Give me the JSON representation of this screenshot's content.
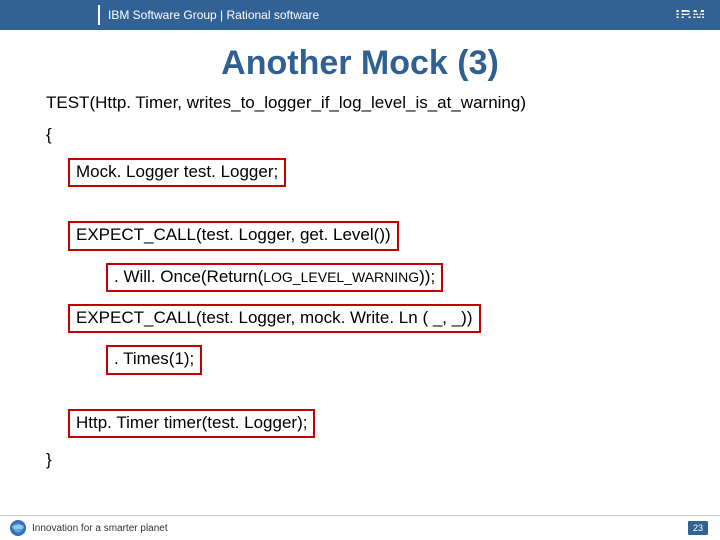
{
  "banner": {
    "group_text": "IBM Software Group | Rational software",
    "logo_text": "IBM"
  },
  "title": "Another Mock (3)",
  "code": {
    "test_signature": "TEST(Http. Timer, writes_to_logger_if_log_level_is_at_warning)",
    "open_brace": "{",
    "mock_logger_decl": "Mock. Logger test. Logger;",
    "expect_call_getlevel": "EXPECT_CALL(test. Logger, get. Level())",
    "will_once_prefix": ". Will. Once(Return(",
    "will_once_const": "LOG_LEVEL_WARNING",
    "will_once_suffix": "));",
    "expect_call_writeln": "EXPECT_CALL(test. Logger, mock. Write. Ln ( _, _))",
    "times_1": ". Times(1);",
    "timer_ctor": "Http. Timer timer(test. Logger);",
    "close_brace": "}"
  },
  "footer": {
    "tagline": "Innovation for a smarter planet",
    "page": "23"
  }
}
